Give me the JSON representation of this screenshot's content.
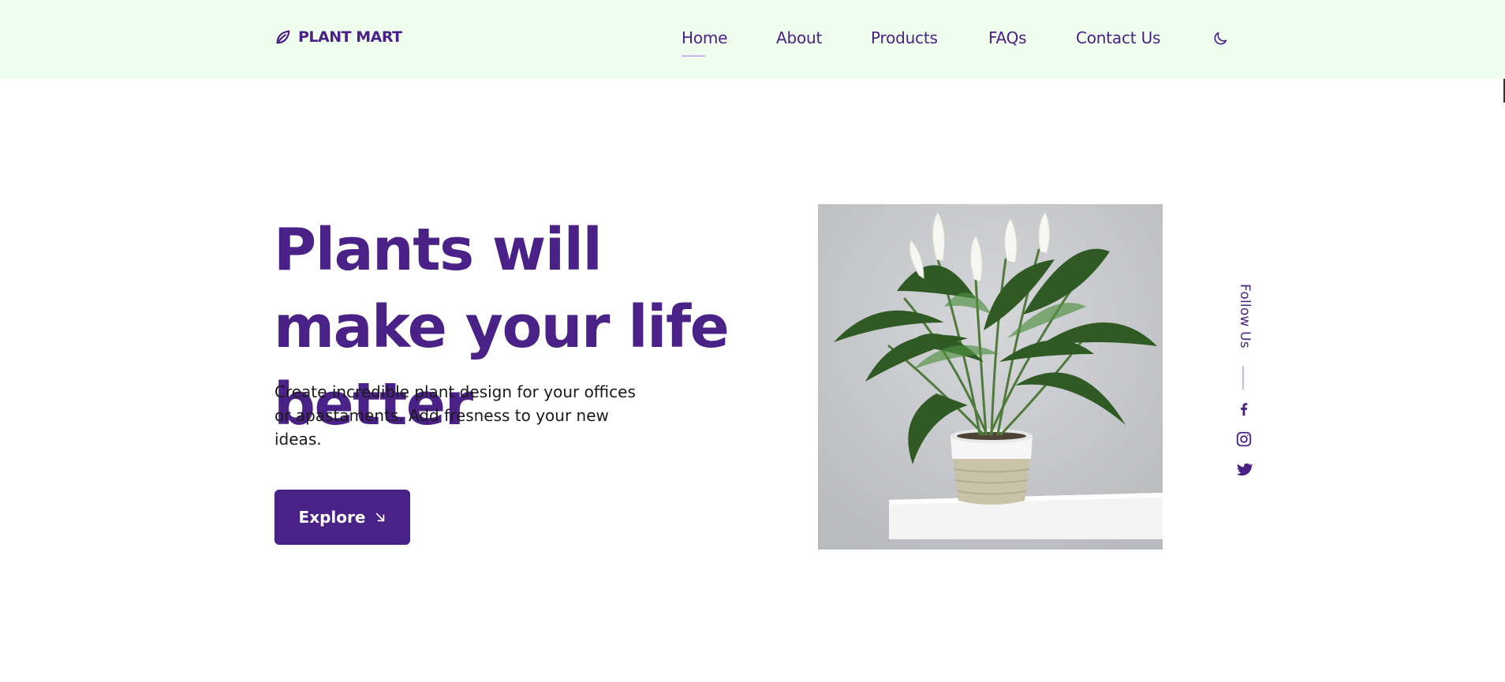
{
  "brand": {
    "name": "PLANT MART",
    "icon": "leaf-icon"
  },
  "nav": {
    "items": [
      {
        "label": "Home",
        "active": true
      },
      {
        "label": "About",
        "active": false
      },
      {
        "label": "Products",
        "active": false
      },
      {
        "label": "FAQs",
        "active": false
      },
      {
        "label": "Contact Us",
        "active": false
      }
    ],
    "theme_toggle_icon": "moon-icon"
  },
  "hero": {
    "title": "Plants will make your life better",
    "description": "Create incredible plant design for your offices or apastaments. Add fresness to your new ideas.",
    "button_label": "Explore",
    "button_icon": "arrow-down-right-icon",
    "image_icon": "potted-peace-lily-image"
  },
  "social": {
    "label": "Follow Us",
    "icons": [
      "facebook-icon",
      "instagram-icon",
      "twitter-icon"
    ]
  },
  "colors": {
    "accent": "#4a2186",
    "header_bg": "#effdef",
    "underline": "#c9b6ee"
  }
}
